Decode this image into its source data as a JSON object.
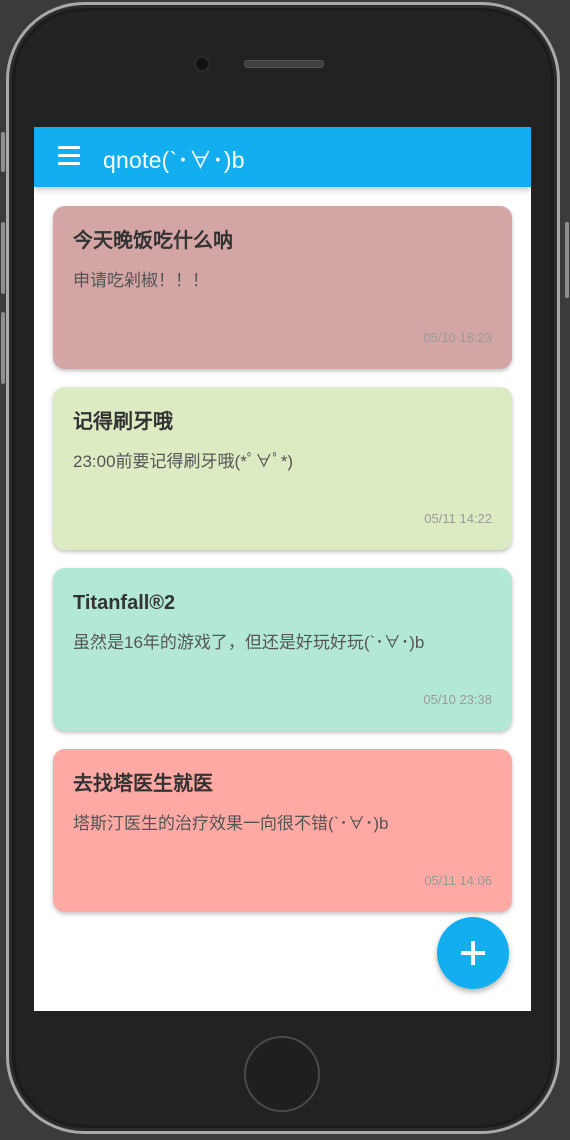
{
  "app": {
    "title": "qnote(`･∀･)b"
  },
  "icons": {
    "menu": "menu-icon",
    "add": "plus-icon"
  },
  "colors": {
    "appbar": "#12aef0",
    "fab": "#12aef0"
  },
  "notes": [
    {
      "title": "今天晚饭吃什么呐",
      "body": "申请吃剁椒！！！",
      "time": "05/10 18:23",
      "color": "#d3a5a5"
    },
    {
      "title": "记得刷牙哦",
      "body": "23:00前要记得刷牙哦(*ﾟ∀ﾟ*)",
      "time": "05/11 14:22",
      "color": "#dcebc2"
    },
    {
      "title": "Titanfall®2",
      "body": "虽然是16年的游戏了，但还是好玩好玩(`･∀･)b",
      "time": "05/10 23:38",
      "color": "#b3e8d6"
    },
    {
      "title": "去找塔医生就医",
      "body": "塔斯汀医生的治疗效果一向很不错(`･∀･)b",
      "time": "05/11 14:06",
      "color": "#fea9a4"
    }
  ]
}
